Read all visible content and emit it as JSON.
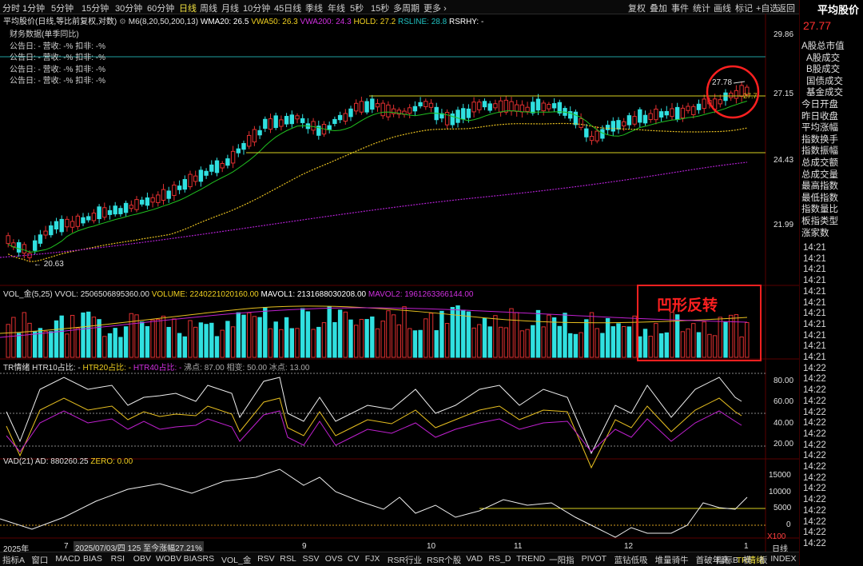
{
  "top_periods": [
    "分时",
    "1分钟",
    "5分钟",
    "15分钟",
    "30分钟",
    "60分钟",
    "日线",
    "周线",
    "月线",
    "10分钟",
    "45日线",
    "季线",
    "年线",
    "5秒",
    "15秒",
    "多周期",
    "更多"
  ],
  "top_selected": "日线",
  "top_right": [
    "复权",
    "叠加",
    "事件",
    "统计",
    "画线",
    "标记",
    "+自选",
    "返回"
  ],
  "side": {
    "title": "平均股价",
    "price": "27.77",
    "items": [
      "A股总市值",
      "A股成交",
      "B股成交",
      "国债成交",
      "基金成交",
      "今日开盘",
      "昨日收盘",
      "平均涨幅",
      "指数换手",
      "指数振幅",
      "总成交额",
      "总成交量",
      "最高指数",
      "最低指数",
      "指数量比",
      "板指类型",
      "涨家数"
    ],
    "times": [
      "14:21",
      "14:21",
      "14:21",
      "14:21",
      "14:21",
      "14:21",
      "14:21",
      "14:21",
      "14:21",
      "14:21",
      "14:21",
      "14:22",
      "14:22",
      "14:22",
      "14:22",
      "14:22",
      "14:22",
      "14:22",
      "14:22",
      "14:22",
      "14:22",
      "14:22",
      "14:22",
      "14:22",
      "14:22",
      "14:22",
      "14:22",
      "14:22"
    ]
  },
  "main_legend": {
    "name": "平均股价(日线,等比前复权,对数)",
    "ma": "M6(8,20,50,200,13)",
    "wma20": "WMA20: 26.5",
    "vwa50": "VWA50: 26.3",
    "vwa200": "VWA200: 24.3",
    "hold": "HOLD: 27.2",
    "rsline": "RSLINE: 28.8",
    "rsrhy": "RSRHY: -"
  },
  "fin_box": {
    "title": "财务数据(单季同比)",
    "rows": [
      "公告日: -    营收: -%    扣非: -%",
      "公告日: -    营收: -%    扣非: -%",
      "公告日: -    营收: -%    扣非: -%",
      "公告日: -    营收: -%    扣非: -%"
    ]
  },
  "price_axis": [
    "29.86",
    "27.15",
    "24.43",
    "21.99"
  ],
  "annotations": {
    "high_label": "27.78",
    "low_label": "20.63",
    "close_label": "27.7"
  },
  "vol_legend": {
    "name": "VOL_金(5,25)",
    "vvol": "VVOL: 2506506895360.00",
    "volume": "VOLUME: 2240221020160.00",
    "mavol1": "MAVOL1: 2131688030208.00",
    "mavol2": "MAVOL2: 1961263366144.00"
  },
  "pattern_label": "凹形反转",
  "tr_legend": {
    "name": "TR情绪",
    "h10": "HTR10占比: -",
    "h20": "HTR20占比: -",
    "h40": "HTR40占比: -",
    "boil": "沸点: 87.00",
    "ice": "相变: 50.00",
    "freeze": "冰点: 13.00"
  },
  "tr_axis": [
    "80.00",
    "60.00",
    "40.00",
    "20.00"
  ],
  "vad_legend": {
    "name": "VAD(21)",
    "ad": "AD: 880260.25",
    "zero": "ZERO: 0.00"
  },
  "vad_axis": [
    "15000",
    "10000",
    "5000",
    "0"
  ],
  "vad_unit": "X100",
  "x_axis": [
    "2025年",
    "7",
    "9",
    "10",
    "11",
    "12",
    "1"
  ],
  "x_period_label": "日线",
  "info_tip": "2025/07/03/四 125 至今涨幅27.21%",
  "bottom_tabs": [
    "指标A",
    "窗口",
    "MACD",
    "BIAS",
    "RSI",
    "OBV",
    "WOBV",
    "BIASRS",
    "VOL_金",
    "RSV",
    "RSL",
    "SSV",
    "OVS",
    "CV",
    "FJX",
    "RSR行业",
    "RSR个股",
    "VAD",
    "RS_D",
    "TREND",
    "一阳指",
    "PIVOT",
    "蓝钻低吸",
    "堆量骑牛",
    "首破年高",
    "TR情绪",
    "INDEX"
  ],
  "bottom_active": "TR情绪",
  "bottom_right": [
    "指标B",
    "模",
    "板"
  ],
  "colors": {
    "up": "#e03030",
    "down": "#30e0e0",
    "ma_green": "#20c020",
    "ma_yellow": "#e8c020",
    "ma_purple": "#b020d0",
    "hline": "#d8d020",
    "teal": "#20a0a0",
    "circle": "#ff2020"
  }
}
